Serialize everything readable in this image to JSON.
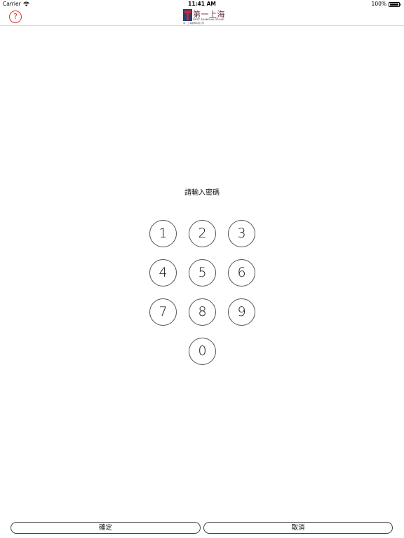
{
  "status_bar": {
    "carrier": "Carrier",
    "time": "11:41 AM",
    "battery": "100%",
    "wifi_icon": "wifi-icon",
    "battery_icon": "battery-icon"
  },
  "nav": {
    "help_icon": "question-icon",
    "help_glyph": "?",
    "help_color": "#dd3333",
    "logo": {
      "title": "第一上海",
      "subtitle": "FIRST SHANGHAI GROUP",
      "tagline": "第一上海證券有限公司"
    }
  },
  "prompt": "請輸入密碼",
  "keypad": {
    "keys": [
      "1",
      "2",
      "3",
      "4",
      "5",
      "6",
      "7",
      "8",
      "9",
      "0"
    ]
  },
  "actions": {
    "confirm_label": "確定",
    "cancel_label": "取消"
  }
}
